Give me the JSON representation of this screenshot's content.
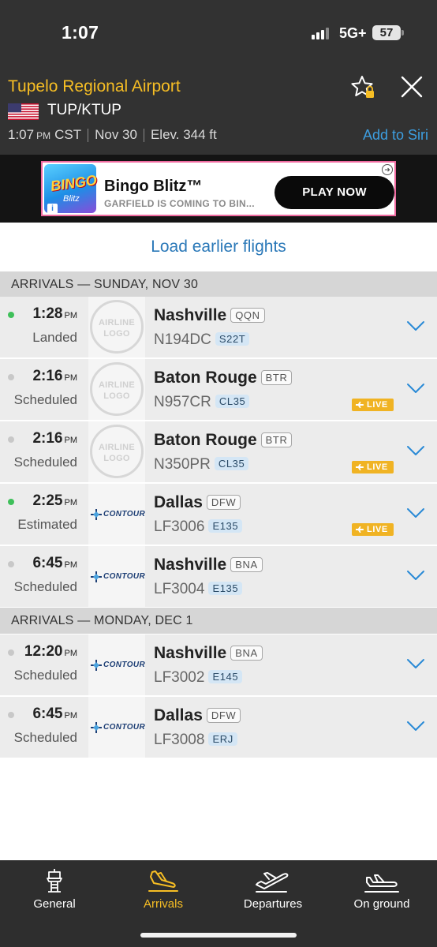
{
  "status_bar": {
    "time": "1:07",
    "network": "5G+",
    "battery": "57"
  },
  "airport": {
    "name": "Tupelo Regional Airport",
    "codes": "TUP/KTUP",
    "local_time": "1:07",
    "local_time_ampm": "PM",
    "timezone": "CST",
    "date": "Nov 30",
    "elevation": "Elev. 344 ft",
    "siri_label": "Add to Siri"
  },
  "ad": {
    "title": "Bingo Blitz™",
    "subtitle": "GARFIELD IS COMING TO BIN...",
    "cta": "PLAY NOW",
    "logo_text": "BINGO",
    "logo_sub": "Blitz"
  },
  "load_earlier": "Load earlier flights",
  "sections": [
    {
      "header": "ARRIVALS — SUNDAY, NOV 30"
    },
    {
      "header": "ARRIVALS — MONDAY, DEC 1"
    }
  ],
  "generic_logo": {
    "line1": "AIRLINE",
    "line2": "LOGO"
  },
  "contour_logo": "CONTOUR",
  "live_label": "LIVE",
  "flights": [
    {
      "time": "1:28",
      "ampm": "PM",
      "status": "Landed",
      "dot": "green",
      "logo": "generic",
      "city": "Nashville",
      "code": "QQN",
      "flight": "N194DC",
      "aircraft": "S22T",
      "live": false
    },
    {
      "time": "2:16",
      "ampm": "PM",
      "status": "Scheduled",
      "dot": "grey",
      "logo": "generic",
      "city": "Baton Rouge",
      "code": "BTR",
      "flight": "N957CR",
      "aircraft": "CL35",
      "live": true
    },
    {
      "time": "2:16",
      "ampm": "PM",
      "status": "Scheduled",
      "dot": "grey",
      "logo": "generic",
      "city": "Baton Rouge",
      "code": "BTR",
      "flight": "N350PR",
      "aircraft": "CL35",
      "live": true
    },
    {
      "time": "2:25",
      "ampm": "PM",
      "status": "Estimated",
      "dot": "green",
      "logo": "contour",
      "city": "Dallas",
      "code": "DFW",
      "flight": "LF3006",
      "aircraft": "E135",
      "live": true
    },
    {
      "time": "6:45",
      "ampm": "PM",
      "status": "Scheduled",
      "dot": "grey",
      "logo": "contour",
      "city": "Nashville",
      "code": "BNA",
      "flight": "LF3004",
      "aircraft": "E135",
      "live": false
    },
    {
      "time": "12:20",
      "ampm": "PM",
      "status": "Scheduled",
      "dot": "grey",
      "logo": "contour",
      "city": "Nashville",
      "code": "BNA",
      "flight": "LF3002",
      "aircraft": "E145",
      "live": false
    },
    {
      "time": "6:45",
      "ampm": "PM",
      "status": "Scheduled",
      "dot": "grey",
      "logo": "contour",
      "city": "Dallas",
      "code": "DFW",
      "flight": "LF3008",
      "aircraft": "ERJ",
      "live": false
    }
  ],
  "tabs": [
    {
      "label": "General",
      "icon": "control-tower-icon",
      "active": false
    },
    {
      "label": "Arrivals",
      "icon": "plane-landing-icon",
      "active": true
    },
    {
      "label": "Departures",
      "icon": "plane-takeoff-icon",
      "active": false
    },
    {
      "label": "On ground",
      "icon": "plane-on-ground-icon",
      "active": false
    }
  ],
  "colors": {
    "accent": "#f7be24",
    "link": "#2a78b8",
    "live": "#f0b323",
    "landed_dot": "#3fc05a"
  }
}
